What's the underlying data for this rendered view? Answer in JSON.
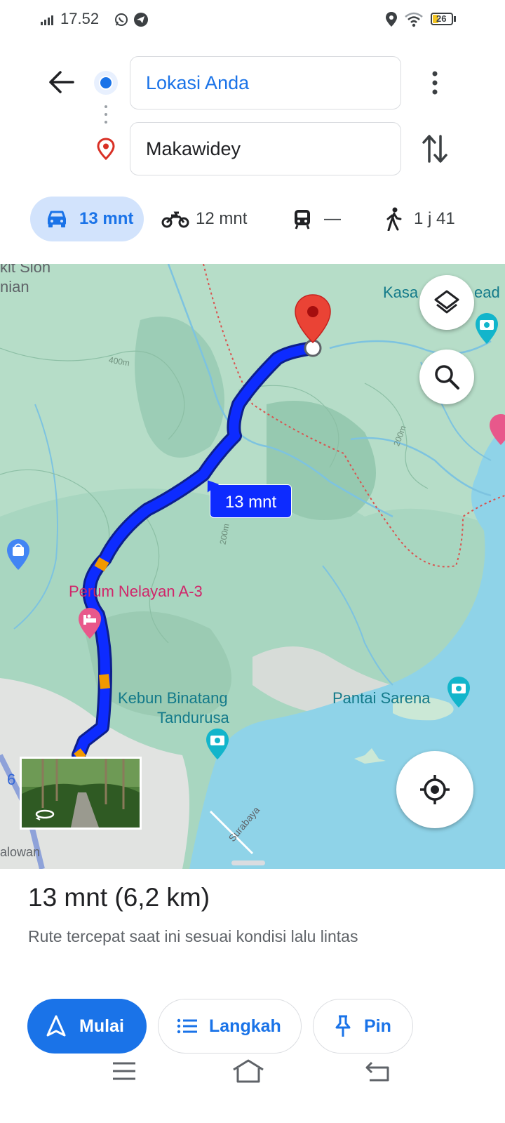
{
  "status_bar": {
    "time": "17.52",
    "battery": "26"
  },
  "directions": {
    "origin": "Lokasi Anda",
    "destination": "Makawidey"
  },
  "modes": [
    {
      "icon": "car-icon",
      "label": "13 mnt",
      "active": true
    },
    {
      "icon": "motorcycle-icon",
      "label": "12 mnt",
      "active": false
    },
    {
      "icon": "transit-icon",
      "label": "—",
      "active": false
    },
    {
      "icon": "walk-icon",
      "label": "1 j 41",
      "active": false
    }
  ],
  "map": {
    "labels": {
      "sion_1": "kit Sion",
      "sion_2": "nian",
      "kasa": "Kasa",
      "kasa_right": "ead",
      "perum": "Perum Nelayan A-3",
      "kebun_1": "Kebun Binatang",
      "kebun_2": "Tandurusa",
      "pantai": "Pantai Sarena",
      "surabaya": "Surabaya",
      "contour_400": "400m",
      "contour_200a": "200m",
      "contour_200b": "200m",
      "edge_6": "6",
      "edge_bottom": "alowan"
    },
    "route_bubble": "13 mnt",
    "colors": {
      "route": "#0d2bff",
      "route_traffic": "#f29900",
      "destination_pin": "#ea4335",
      "water": "#8fd3e8",
      "terrain": "#a8d6c0"
    }
  },
  "sheet": {
    "title": "13 mnt (6,2 km)",
    "subtitle": "Rute tercepat saat ini sesuai kondisi lalu lintas",
    "buttons": {
      "start": "Mulai",
      "steps": "Langkah",
      "pin": "Pin"
    }
  }
}
